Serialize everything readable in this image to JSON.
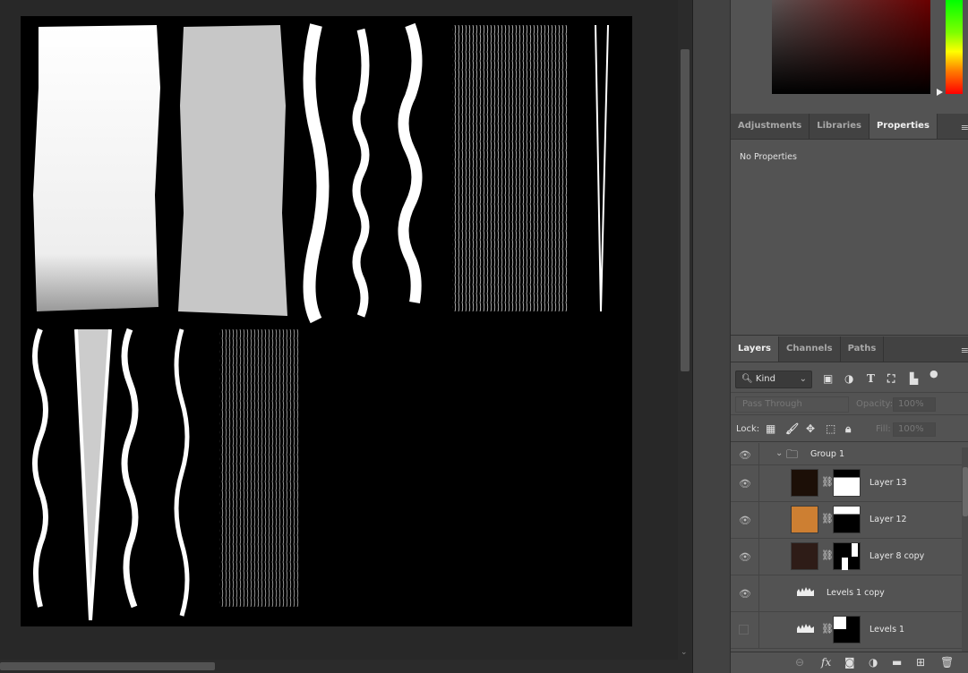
{
  "properties_panel": {
    "tabs": [
      {
        "label": "Adjustments"
      },
      {
        "label": "Libraries"
      },
      {
        "label": "Properties"
      }
    ],
    "active_tab": "Properties",
    "body": "No Properties"
  },
  "layers_panel": {
    "tabs": [
      {
        "label": "Layers"
      },
      {
        "label": "Channels"
      },
      {
        "label": "Paths"
      }
    ],
    "active_tab": "Layers",
    "filter": {
      "label": "Kind",
      "icons": [
        "image-filter-icon",
        "adjustment-filter-icon",
        "type-filter-icon",
        "shape-filter-icon",
        "smart-object-filter-icon",
        "filter-toggle"
      ]
    },
    "blend_mode": "Pass Through",
    "opacity_label": "Opacity:",
    "opacity": "100%",
    "lock_label": "Lock:",
    "fill_label": "Fill:",
    "fill": "100%",
    "layers": [
      {
        "name": "Group 1",
        "type": "group",
        "visible": true
      },
      {
        "name": "Layer 13",
        "type": "fill",
        "color": "#1c0f07",
        "visible": true
      },
      {
        "name": "Layer 12",
        "type": "fill",
        "color": "#cd7f32",
        "visible": true
      },
      {
        "name": "Layer 8 copy",
        "type": "fill",
        "color": "#2e1c17",
        "visible": true
      },
      {
        "name": "Levels 1 copy",
        "type": "adjustment",
        "visible": true
      },
      {
        "name": "Levels 1",
        "type": "adjustment",
        "visible": false
      }
    ],
    "footer_icons": [
      "link-layers-icon",
      "fx-icon",
      "add-mask-icon",
      "new-adjustment-icon",
      "new-group-icon",
      "new-layer-icon",
      "delete-icon"
    ]
  }
}
